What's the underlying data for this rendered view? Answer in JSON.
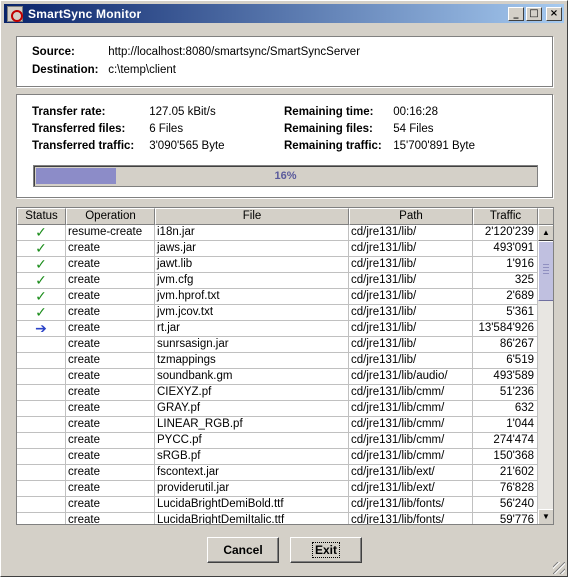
{
  "window": {
    "title": "SmartSync Monitor",
    "minimize_label": "_",
    "maximize_label": "□",
    "close_label": "×"
  },
  "source": {
    "source_label": "Source:",
    "source_value": "http://localhost:8080/smartsync/SmartSyncServer",
    "destination_label": "Destination:",
    "destination_value": "c:\\temp\\client"
  },
  "stats": {
    "transfer_rate_label": "Transfer rate:",
    "transfer_rate_value": "127.05 kBit/s",
    "transferred_files_label": "Transferred files:",
    "transferred_files_value": "6 Files",
    "transferred_traffic_label": "Transferred traffic:",
    "transferred_traffic_value": "3'090'565 Byte",
    "remaining_time_label": "Remaining time:",
    "remaining_time_value": "00:16:28",
    "remaining_files_label": "Remaining files:",
    "remaining_files_value": "54 Files",
    "remaining_traffic_label": "Remaining traffic:",
    "remaining_traffic_value": "15'700'891 Byte"
  },
  "progress": {
    "percent": 16,
    "label": "16%"
  },
  "table": {
    "columns": [
      "Status",
      "Operation",
      "File",
      "Path",
      "Traffic"
    ],
    "rows": [
      {
        "status": "done",
        "operation": "resume-create",
        "file": "i18n.jar",
        "path": "cd/jre131/lib/",
        "traffic": "2'120'239"
      },
      {
        "status": "done",
        "operation": "create",
        "file": "jaws.jar",
        "path": "cd/jre131/lib/",
        "traffic": "493'091"
      },
      {
        "status": "done",
        "operation": "create",
        "file": "jawt.lib",
        "path": "cd/jre131/lib/",
        "traffic": "1'916"
      },
      {
        "status": "done",
        "operation": "create",
        "file": "jvm.cfg",
        "path": "cd/jre131/lib/",
        "traffic": "325"
      },
      {
        "status": "done",
        "operation": "create",
        "file": "jvm.hprof.txt",
        "path": "cd/jre131/lib/",
        "traffic": "2'689"
      },
      {
        "status": "done",
        "operation": "create",
        "file": "jvm.jcov.txt",
        "path": "cd/jre131/lib/",
        "traffic": "5'361"
      },
      {
        "status": "active",
        "operation": "create",
        "file": "rt.jar",
        "path": "cd/jre131/lib/",
        "traffic": "13'584'926"
      },
      {
        "status": "",
        "operation": "create",
        "file": "sunrsasign.jar",
        "path": "cd/jre131/lib/",
        "traffic": "86'267"
      },
      {
        "status": "",
        "operation": "create",
        "file": "tzmappings",
        "path": "cd/jre131/lib/",
        "traffic": "6'519"
      },
      {
        "status": "",
        "operation": "create",
        "file": "soundbank.gm",
        "path": "cd/jre131/lib/audio/",
        "traffic": "493'589"
      },
      {
        "status": "",
        "operation": "create",
        "file": "CIEXYZ.pf",
        "path": "cd/jre131/lib/cmm/",
        "traffic": "51'236"
      },
      {
        "status": "",
        "operation": "create",
        "file": "GRAY.pf",
        "path": "cd/jre131/lib/cmm/",
        "traffic": "632"
      },
      {
        "status": "",
        "operation": "create",
        "file": "LINEAR_RGB.pf",
        "path": "cd/jre131/lib/cmm/",
        "traffic": "1'044"
      },
      {
        "status": "",
        "operation": "create",
        "file": "PYCC.pf",
        "path": "cd/jre131/lib/cmm/",
        "traffic": "274'474"
      },
      {
        "status": "",
        "operation": "create",
        "file": "sRGB.pf",
        "path": "cd/jre131/lib/cmm/",
        "traffic": "150'368"
      },
      {
        "status": "",
        "operation": "create",
        "file": "fscontext.jar",
        "path": "cd/jre131/lib/ext/",
        "traffic": "21'602"
      },
      {
        "status": "",
        "operation": "create",
        "file": "providerutil.jar",
        "path": "cd/jre131/lib/ext/",
        "traffic": "76'828"
      },
      {
        "status": "",
        "operation": "create",
        "file": "LucidaBrightDemiBold.ttf",
        "path": "cd/jre131/lib/fonts/",
        "traffic": "56'240"
      },
      {
        "status": "",
        "operation": "create",
        "file": "LucidaBrightDemiItalic.ttf",
        "path": "cd/jre131/lib/fonts/",
        "traffic": "59'776"
      }
    ]
  },
  "buttons": {
    "cancel": "Cancel",
    "exit": "Exit"
  }
}
